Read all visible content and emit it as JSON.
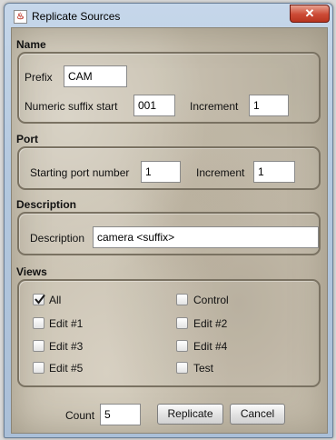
{
  "window": {
    "title": "Replicate Sources",
    "close_glyph": "✕"
  },
  "name_section": {
    "title": "Name",
    "prefix_label": "Prefix",
    "prefix_value": "CAM",
    "suffix_start_label": "Numeric suffix start",
    "suffix_start_value": "001",
    "increment_label": "Increment",
    "increment_value": "1"
  },
  "port_section": {
    "title": "Port",
    "start_label": "Starting port number",
    "start_value": "1",
    "increment_label": "Increment",
    "increment_value": "1"
  },
  "description_section": {
    "title": "Description",
    "label": "Description",
    "value": "camera <suffix>"
  },
  "views_section": {
    "title": "Views",
    "items": [
      {
        "label": "All",
        "checked": true
      },
      {
        "label": "Control",
        "checked": false
      },
      {
        "label": "Edit #1",
        "checked": false
      },
      {
        "label": "Edit #2",
        "checked": false
      },
      {
        "label": "Edit #3",
        "checked": false
      },
      {
        "label": "Edit #4",
        "checked": false
      },
      {
        "label": "Edit #5",
        "checked": false
      },
      {
        "label": "Test",
        "checked": false
      }
    ]
  },
  "footer": {
    "count_label": "Count",
    "count_value": "5",
    "replicate_label": "Replicate",
    "cancel_label": "Cancel"
  }
}
